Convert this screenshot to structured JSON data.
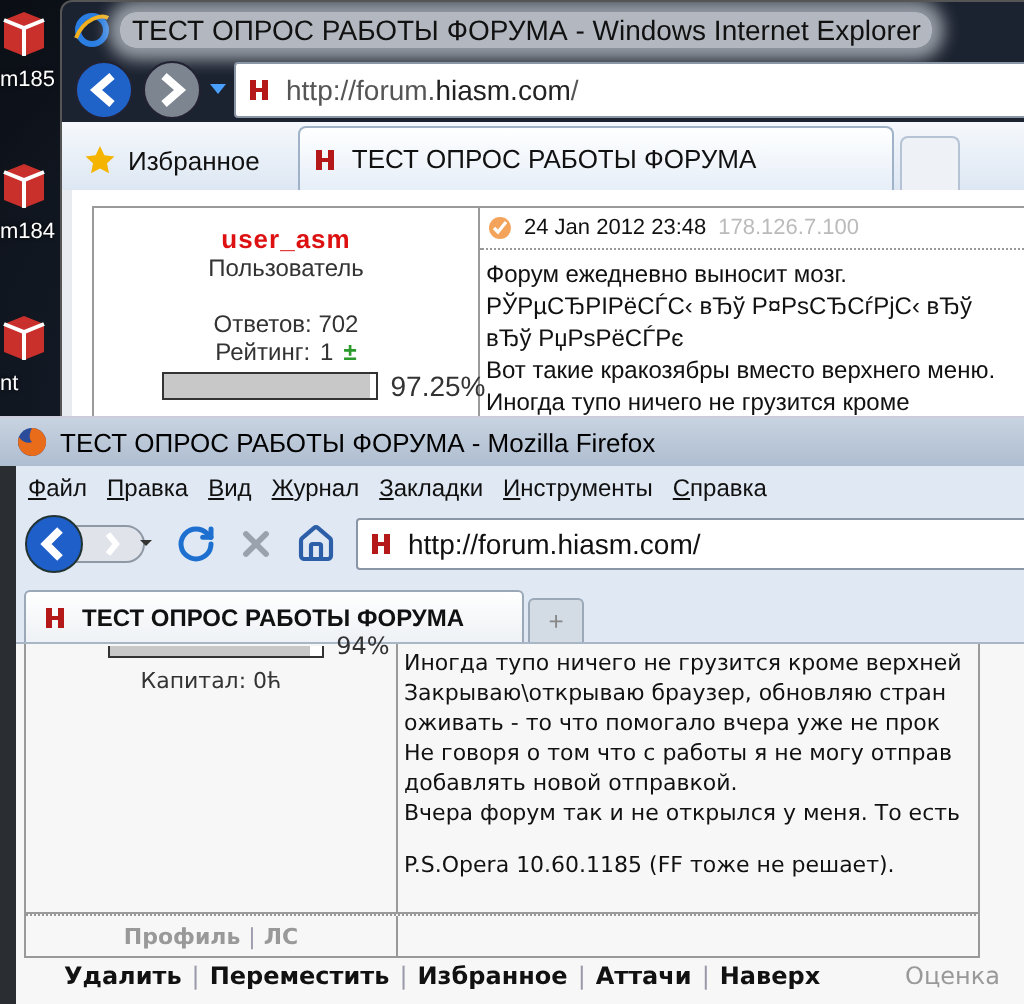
{
  "desktop_icons": [
    {
      "label": "m185"
    },
    {
      "label": "m184"
    },
    {
      "label": "nt"
    }
  ],
  "ie_window": {
    "title": "ТЕСТ ОПРОС РАБОТЫ ФОРУМА - Windows Internet Explorer",
    "address": "http://forum.**hiasm.com**/",
    "favorites": "Избранное",
    "tab": "ТЕСТ ОПРОС РАБОТЫ ФОРУМА",
    "post": {
      "author": "user_asm",
      "role": "Пользователь",
      "replies": "Ответов: 702",
      "rating_label": "Рейтинг:",
      "rating": "1",
      "rating_sign": "±",
      "level": 0.9725,
      "percent": "97.25%",
      "date": "24 Jan 2012 23:48",
      "ip": "178.126.7.100",
      "lines": [
        "Форум ежедневно выносит мозг.",
        "РЎРµСЂРІРёСЃС‹ вЂў Р¤РѕСЂСѓРјС‹ вЂў",
        "вЂў РџРѕРёСЃРє",
        "Вот такие кракозябры вместо верхнего меню.",
        "Иногда тупо ничего не грузится кроме"
      ]
    }
  },
  "firefox_window": {
    "title": "ТЕСТ ОПРОС РАБОТЫ ФОРУМА - Mozilla Firefox",
    "menu": [
      "Файл",
      "Правка",
      "Вид",
      "Журнал",
      "Закладки",
      "Инструменты",
      "Справка"
    ],
    "address": "http://forum.hiasm.com/",
    "tabs": [
      {
        "title": "ТЕСТ ОПРОС РАБОТЫ ФОРУМА",
        "selected": true
      }
    ],
    "new_tab": "+",
    "post": {
      "level": 0.94,
      "percent": "94%",
      "capital": "Капитал: 0ћ",
      "lines": [
        "Иногда тупо ничего не грузится кроме верхней",
        "Закрываю\\открываю браузер, обновляю стран",
        "оживать - то что помогало вчера уже не прок",
        "Не говоря о том что с работы я не могу отправ",
        "добавлять новой отправкой.",
        "Вчера форум так и не открылся у меня. То есть"
      ],
      "ps": "P.S.Opera 10.60.1185 (FF тоже не решает).",
      "links": [
        "Профиль",
        "ЛС"
      ]
    },
    "separator": "|",
    "actions": [
      "Удалить",
      "Переместить",
      "Избранное",
      "Аттачи",
      "Наверх"
    ],
    "rating_label": "Оценка"
  }
}
